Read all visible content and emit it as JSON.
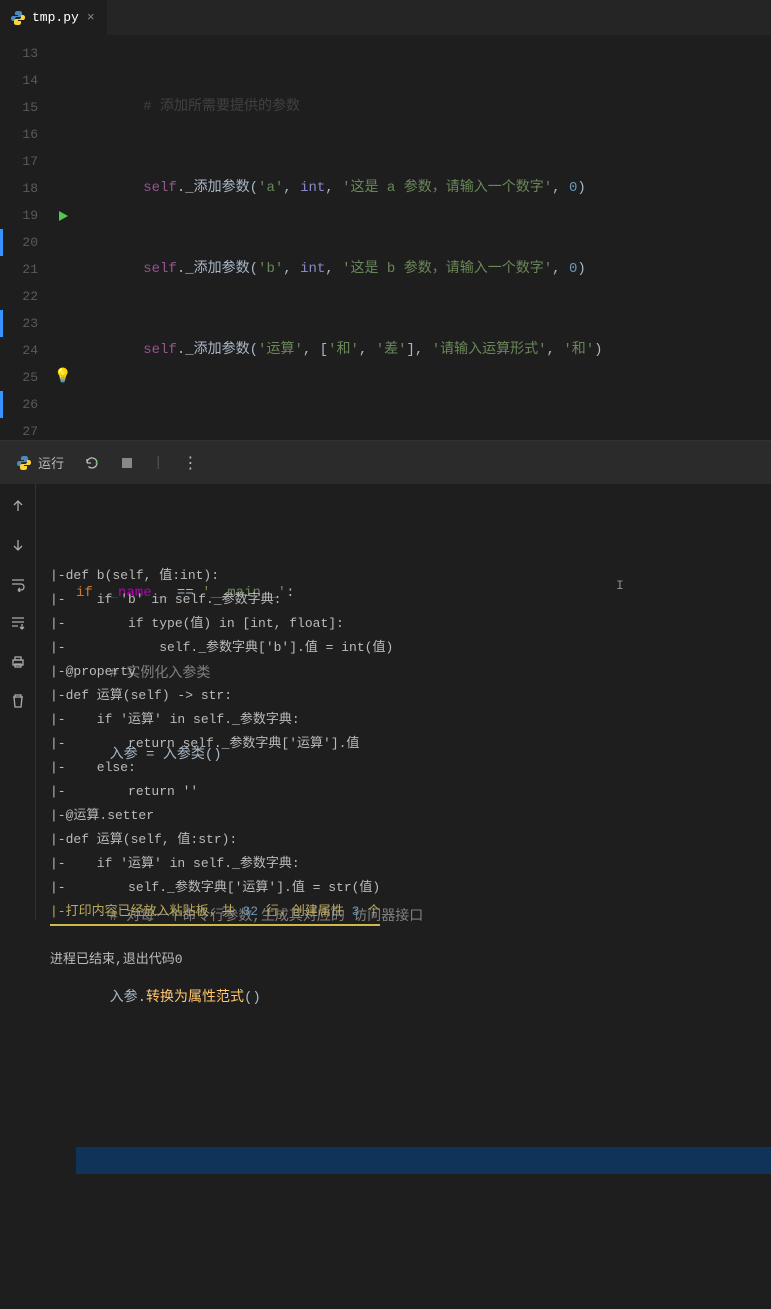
{
  "tab": {
    "filename": "tmp.py",
    "close": "×"
  },
  "gutter": {
    "start": 13,
    "end": 27,
    "marked": [
      20,
      23,
      26
    ],
    "play_line": 19,
    "bulb_line": 25
  },
  "code": {
    "l13_cmt": "# 添加所需要提供的参数",
    "l14": {
      "self": "self",
      "fn": "_添加参数",
      "a": "'a'",
      "t": "int",
      "s": "'这是 a 参数，请输入一个数字'",
      "n": "0"
    },
    "l15": {
      "self": "self",
      "fn": "_添加参数",
      "a": "'b'",
      "t": "int",
      "s": "'这是 b 参数，请输入一个数字'",
      "n": "0"
    },
    "l16": {
      "self": "self",
      "fn": "_添加参数",
      "a": "'运算'",
      "l1": "'和'",
      "l2": "'差'",
      "s": "'请输入运算形式'",
      "d": "'和'"
    },
    "l19": {
      "kw": "if",
      "name": "__name__",
      "eq": "==",
      "main": "'__main__'"
    },
    "l20_cmt": "# 实例化入参类",
    "l21": {
      "v": "入参",
      "eq": "=",
      "cls": "入参类"
    },
    "l23_cmt": "# 对每一个命令行参数,生成其对应的 访问器接口",
    "l24": {
      "v": "入参",
      "fn": "转换为属性范式"
    }
  },
  "panel": {
    "run_label": "运行"
  },
  "output": {
    "lines": [
      "|-def b(self, 值:int):",
      "|-    if 'b' in self._参数字典:",
      "|-        if type(值) in [int, float]:",
      "|-            self._参数字典['b'].值 = int(值)",
      "|-@property",
      "|-def 运算(self) -> str:",
      "|-    if '运算' in self._参数字典:",
      "|-        return self._参数字典['运算'].值",
      "|-    else:",
      "|-        return ''",
      "|-@运算.setter",
      "|-def 运算(self, 值:str):",
      "|-    if '运算' in self._参数字典:",
      "|-        self._参数字典['运算'].值 = str(值)"
    ],
    "highlight": {
      "pre": "|-打印内容已经放入粘贴板，共 ",
      "n1": "32",
      "mid": " 行，创建属性 ",
      "n2": "3",
      "post": " 个"
    },
    "blank": "",
    "end": "进程已结束,退出代码0"
  }
}
